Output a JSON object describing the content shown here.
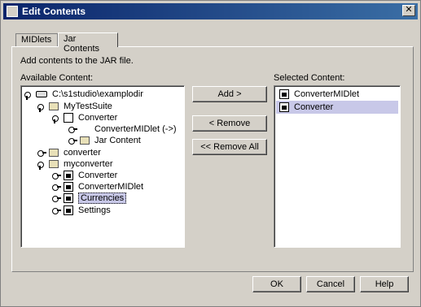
{
  "window": {
    "title": "Edit Contents",
    "close_glyph": "✕"
  },
  "tabs": [
    {
      "label": "MIDlets",
      "active": false
    },
    {
      "label": "Jar Contents",
      "active": true
    }
  ],
  "instruction": "Add contents to the JAR file.",
  "available": {
    "label": "Available Content:",
    "tree": [
      {
        "label": "C:\\s1studio\\examplodir",
        "icon": "drive-icon",
        "level": 0
      },
      {
        "label": "MyTestSuite",
        "icon": "folder-open-icon",
        "level": 1
      },
      {
        "label": "Converter",
        "icon": "class-icon",
        "level": 2
      },
      {
        "label": "ConverterMIDlet (->)",
        "icon": "midlet-icon",
        "level": 3
      },
      {
        "label": "Jar Content",
        "icon": "jar-icon",
        "level": 3
      },
      {
        "label": "converter",
        "icon": "folder-icon",
        "level": 1
      },
      {
        "label": "myconverter",
        "icon": "folder-open-icon",
        "level": 1
      },
      {
        "label": "Converter",
        "icon": "java-file-icon",
        "level": 2
      },
      {
        "label": "ConverterMIDlet",
        "icon": "java-file-icon",
        "level": 2
      },
      {
        "label": "Currencies",
        "icon": "java-file-icon",
        "level": 2,
        "selected": true
      },
      {
        "label": "Settings",
        "icon": "java-file-icon",
        "level": 2
      }
    ]
  },
  "buttons": {
    "add": "Add >",
    "remove": "< Remove",
    "remove_all": "<< Remove All"
  },
  "selected": {
    "label": "Selected Content:",
    "items": [
      {
        "label": "ConverterMIDlet",
        "selected": false
      },
      {
        "label": "Converter",
        "selected": true
      }
    ]
  },
  "footer": {
    "ok": "OK",
    "cancel": "Cancel",
    "help": "Help"
  }
}
